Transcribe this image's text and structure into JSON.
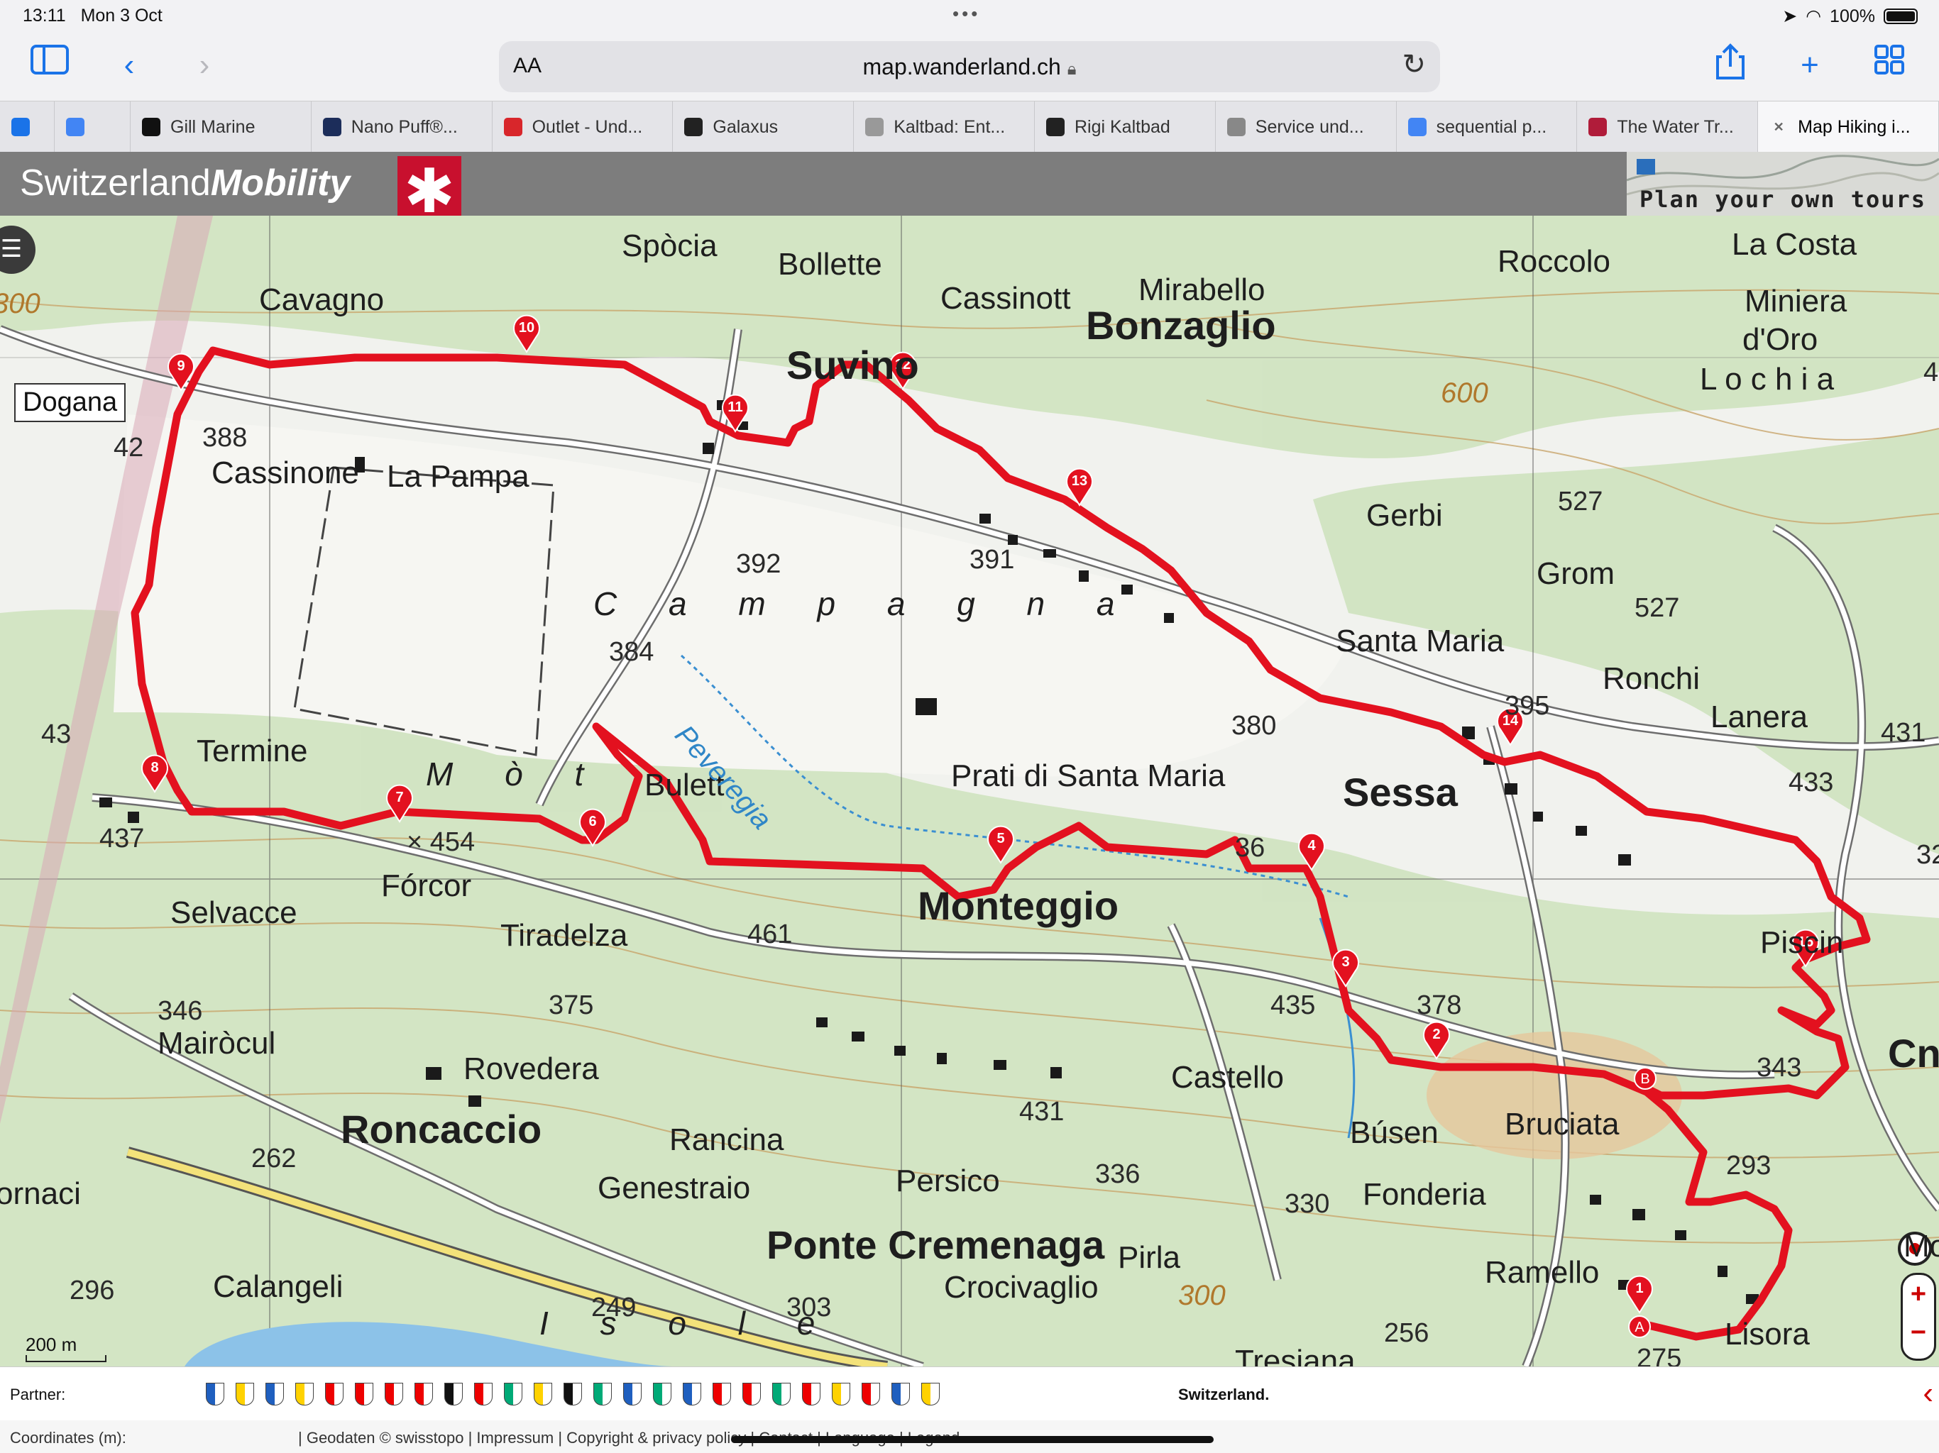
{
  "status": {
    "time": "13:11",
    "date": "Mon 3 Oct",
    "battery": "100%",
    "dots": "•••"
  },
  "toolbar": {
    "text_size_label": "AA",
    "url": "map.wanderland.ch"
  },
  "tabs": [
    {
      "label": "",
      "icon": "partial-tab-icon"
    },
    {
      "label": "",
      "icon": "google-icon"
    },
    {
      "label": "Gill Marine",
      "icon": "gill-icon"
    },
    {
      "label": "Nano Puff®...",
      "icon": "patagonia-icon"
    },
    {
      "label": "Outlet - Und...",
      "icon": "outlet-icon"
    },
    {
      "label": "Galaxus",
      "icon": "galaxus-icon"
    },
    {
      "label": "Kaltbad: Ent...",
      "icon": "kaltbad-icon"
    },
    {
      "label": "Rigi Kaltbad",
      "icon": "rigi-icon"
    },
    {
      "label": "Service und...",
      "icon": "apple-icon"
    },
    {
      "label": "sequential p...",
      "icon": "google-icon"
    },
    {
      "label": "The Water Tr...",
      "icon": "water-icon"
    },
    {
      "label": "Map Hiking i...",
      "icon": "close-icon",
      "active": true
    }
  ],
  "site": {
    "brand_light": "Switzerland",
    "brand_bold": "Mobility",
    "plan_tours": "Plan your own tours"
  },
  "map": {
    "route_color": "#e3111f",
    "dogana": "Dogana",
    "labels": {
      "spocia": "Spòcia",
      "bollette": "Bollette",
      "cavagno": "Cavagno",
      "cassinott": "Cassinott",
      "mirabello": "Mirabello",
      "roccolo": "Roccolo",
      "la_costa": "La Costa",
      "miniera": "Miniera",
      "doro": "d'Oro",
      "lochia": "L o c h i a",
      "bonzaglio": "Bonzaglio",
      "suvino": "Suvino",
      "cassinone": "Cassinone",
      "la_pampa": "La Pampa",
      "campagna": "C a m p a g n a",
      "gerbi": "Gerbi",
      "grom": "Grom",
      "santa_maria": "Santa Maria",
      "ronchi": "Ronchi",
      "lanera": "Lanera",
      "termine": "Termine",
      "bulett": "Bulett",
      "peveregia": "Peveregia",
      "prati": "Prati di Santa Maria",
      "sessa": "Sessa",
      "mot": "M ò t",
      "forcor": "Fórcor",
      "selvacce": "Selvacce",
      "tiradelza": "Tiradelza",
      "monteggio": "Monteggio",
      "mairocul": "Mairòcul",
      "rovedera": "Rovedera",
      "castello": "Castello",
      "bruciata": "Bruciata",
      "roncaccio": "Roncaccio",
      "rancina": "Rancina",
      "busen": "Búsen",
      "fonderia": "Fonderia",
      "genestraio": "Genestraio",
      "persico": "Persico",
      "ponte_cremenaga": "Ponte Cremenaga",
      "pirla": "Pirla",
      "ramello": "Ramello",
      "calangeli": "Calangeli",
      "crocivaglio": "Crocivaglio",
      "isole": "I s o l e",
      "lisora": "Lisora",
      "tresiana": "Tresiana",
      "piscina": "Piscin",
      "cne": "Cne",
      "mo": "Mo",
      "ornaci": "ornaci"
    },
    "altitudes": {
      "a388": "388",
      "a392": "392",
      "a384": "384",
      "a391": "391",
      "a380": "380",
      "a395": "395",
      "a527a": "527",
      "a527b": "527",
      "a431": "431",
      "a433": "433",
      "a437": "437",
      "a454": "× 454",
      "a461": "461",
      "a375": "375",
      "a346": "346",
      "a435": "435",
      "a378": "378",
      "a343": "343",
      "a293": "293",
      "a431b": "431",
      "a262": "262",
      "a336": "336",
      "a330": "330",
      "a296": "296",
      "a249": "249",
      "a303": "303",
      "a256": "256",
      "a275": "275",
      "a36": "36",
      "a32": "32",
      "a42": "42",
      "a43": "43",
      "a4": "4"
    },
    "contours": {
      "c600": "600",
      "c300": "300",
      "c300b": "300"
    },
    "markers": [
      "1",
      "2",
      "3",
      "4",
      "5",
      "6",
      "7",
      "8",
      "9",
      "10",
      "11",
      "12",
      "13",
      "14",
      "15"
    ],
    "ab": {
      "a": "A",
      "b": "B"
    },
    "scale": "200 m",
    "zoom_in": "+",
    "zoom_out": "−"
  },
  "partner": {
    "label": "Partner:",
    "switzerland": "Switzerland."
  },
  "footer": {
    "coordinates": "Coordinates (m):",
    "links": "|  Geodaten © swisstopo  |  Impressum  |  Copyright & privacy policy  |  Contact  |  Language  |  Legend"
  }
}
